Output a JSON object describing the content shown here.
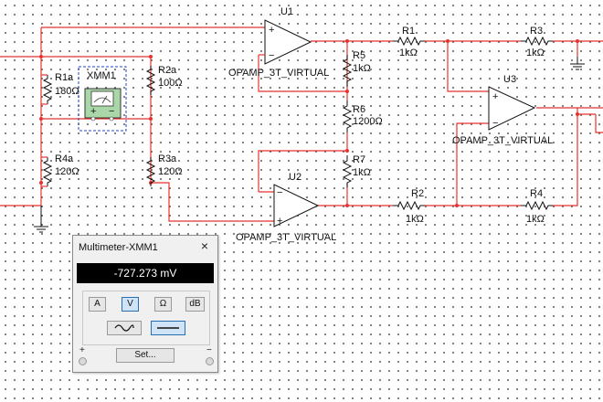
{
  "schematic": {
    "components": {
      "U1": {
        "ref": "U1",
        "model": "OPAMP_3T_VIRTUAL"
      },
      "U2": {
        "ref": "U2",
        "model": "OPAMP_3T_VIRTUAL"
      },
      "U3": {
        "ref": "U3",
        "model": "OPAMP_3T_VIRTUAL"
      },
      "R1": {
        "ref": "R1",
        "value": "1kΩ"
      },
      "R2": {
        "ref": "R2",
        "value": "1kΩ"
      },
      "R3": {
        "ref": "R3",
        "value": "1kΩ"
      },
      "R4": {
        "ref": "R4",
        "value": "1kΩ"
      },
      "R5": {
        "ref": "R5",
        "value": "1kΩ"
      },
      "R6": {
        "ref": "R6",
        "value": "1200Ω"
      },
      "R7": {
        "ref": "R7",
        "value": "1kΩ"
      },
      "R1a": {
        "ref": "R1a",
        "value": "180Ω"
      },
      "R2a": {
        "ref": "R2a",
        "value": "100Ω"
      },
      "R3a": {
        "ref": "R3a",
        "value": "120Ω"
      },
      "R4a": {
        "ref": "R4a",
        "value": "120Ω"
      },
      "XMM1": {
        "ref": "XMM1"
      }
    },
    "colors": {
      "wire": "#e8322d",
      "component": "#111111",
      "instrument_border": "#2244cc",
      "instrument_fill": "#a9d7a8"
    }
  },
  "multimeter": {
    "title": "Multimeter-XMM1",
    "close_glyph": "×",
    "reading": "-727.273 mV",
    "buttons": {
      "amps": "A",
      "volts": "V",
      "ohms": "Ω",
      "db": "dB"
    },
    "selected_mode": "V",
    "ac_icon": "ac-sine-icon",
    "dc_icon": "dc-line-icon",
    "set_label": "Set...",
    "plus_label": "+",
    "minus_label": "−"
  }
}
